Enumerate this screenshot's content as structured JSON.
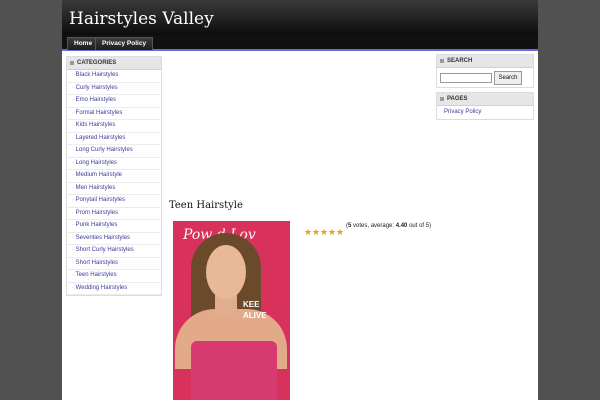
{
  "site": {
    "title": "Hairstyles Valley"
  },
  "nav": {
    "items": [
      "Home",
      "Privacy Policy"
    ]
  },
  "sidebar": {
    "categories_title": "Categories",
    "categories": [
      "Black Hairstyles",
      "Curly Hairstyles",
      "Emo Hairstyles",
      "Formal Hairstyles",
      "Kids Hairstyles",
      "Layered Hairstyles",
      "Long Curly Hairstyles",
      "Long Hairstyles",
      "Medium Hairstyle",
      "Men Hairstyles",
      "Ponytail Hairstyles",
      "Prom Hairstyles",
      "Punk Hairstyles",
      "Seventies Hairstyles",
      "Short Curly Hairstyles",
      "Short Hairstyles",
      "Teen Hairstyles",
      "Wedding Hairstyles"
    ]
  },
  "right": {
    "search_title": "Search",
    "search_button": "Search",
    "search_value": "",
    "pages_title": "Pages",
    "pages": [
      "Privacy Policy"
    ]
  },
  "post": {
    "title": "Teen Hairstyle",
    "photo_text": "Pow  d Lov",
    "photo_text2": "KEE\nALIVE",
    "rating": {
      "stars": 5,
      "stars_filled": 4.4,
      "votes": "5",
      "votes_label": "votes, average:",
      "average": "4.40",
      "out_of": "out of 5)"
    }
  },
  "colors": {
    "link": "#3b3b9a",
    "nav_border": "#6a6ad8",
    "header": "#1a1a1a"
  }
}
